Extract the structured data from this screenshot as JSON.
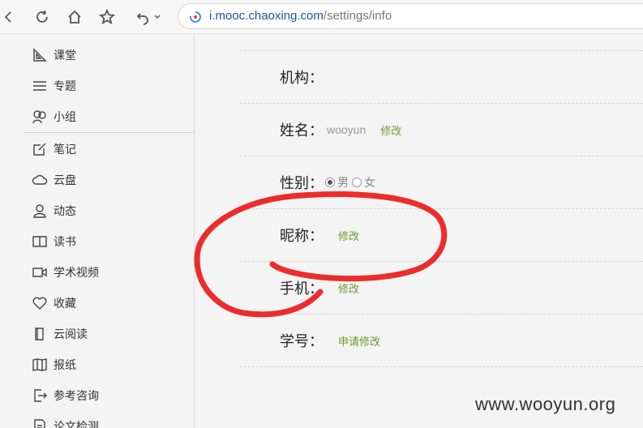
{
  "browser": {
    "url_host": "i.mooc.chaoxing.com",
    "url_path": "/settings/info"
  },
  "sidebar": {
    "items": [
      {
        "label": "课堂",
        "icon": "classroom-icon"
      },
      {
        "label": "专题",
        "icon": "topic-icon"
      },
      {
        "label": "小组",
        "icon": "group-icon"
      },
      {
        "label": "笔记",
        "icon": "note-icon"
      },
      {
        "label": "云盘",
        "icon": "cloud-icon"
      },
      {
        "label": "动态",
        "icon": "user-icon"
      },
      {
        "label": "读书",
        "icon": "book-icon"
      },
      {
        "label": "学术视频",
        "icon": "video-icon"
      },
      {
        "label": "收藏",
        "icon": "heart-icon"
      },
      {
        "label": "云阅读",
        "icon": "reader-icon"
      },
      {
        "label": "报纸",
        "icon": "newspaper-icon"
      },
      {
        "label": "参考咨询",
        "icon": "consult-icon"
      },
      {
        "label": "论文检测",
        "icon": "paper-check-icon"
      }
    ]
  },
  "profile": {
    "org_label": "机构：",
    "name_label": "姓名：",
    "name_value": "wooyun",
    "name_edit": "修改",
    "gender_label": "性别：",
    "gender_male": "男",
    "gender_female": "女",
    "gender_selected": "男",
    "nickname_label": "昵称：",
    "nickname_edit": "修改",
    "phone_label": "手机：",
    "phone_edit": "修改",
    "student_id_label": "学号：",
    "student_id_edit": "申请修改"
  },
  "colors": {
    "edit_link": "#6a9b2a",
    "annotation": "#ee2b2b"
  },
  "watermark": "www.wooyun.org"
}
